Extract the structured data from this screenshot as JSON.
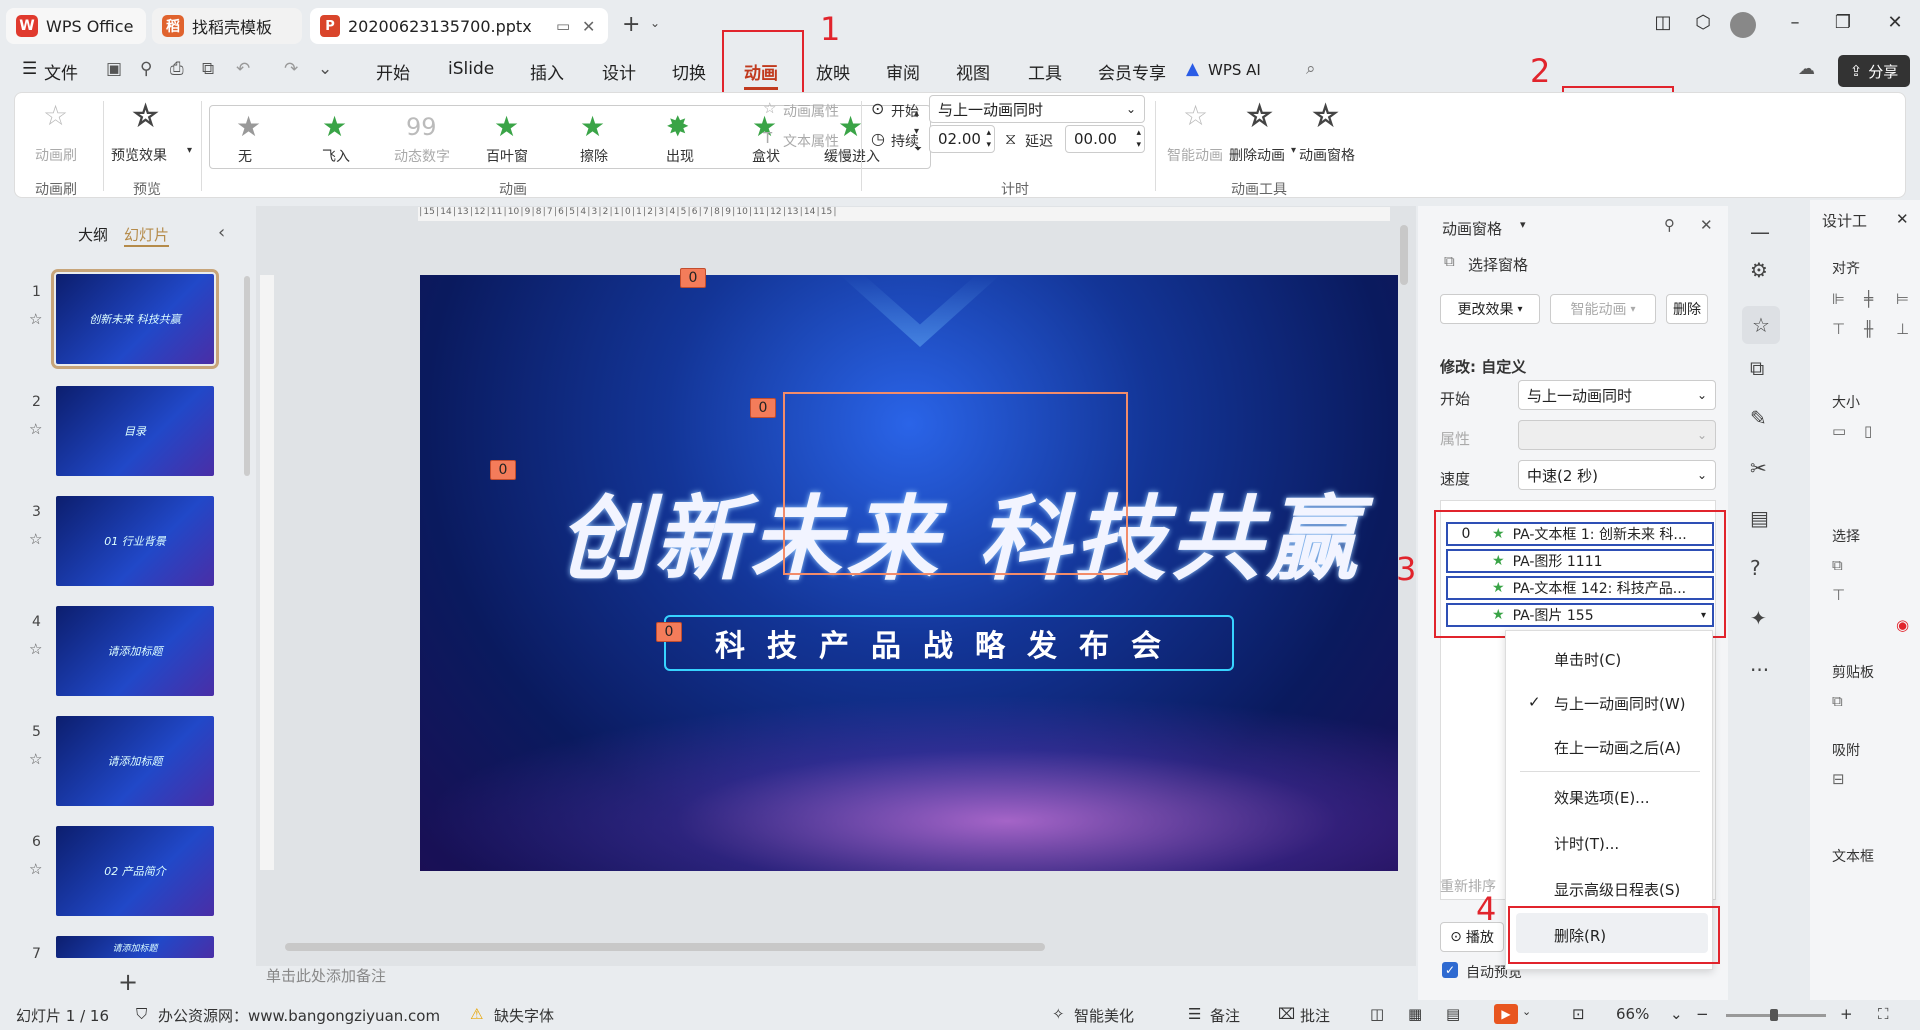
{
  "tabs": {
    "wps": "WPS Office",
    "template": "找稻壳模板",
    "file": "20200623135700.pptx"
  },
  "menu": {
    "file": "文件",
    "items": [
      "开始",
      "iSlide",
      "插入",
      "设计",
      "切换",
      "动画",
      "放映",
      "审阅",
      "视图",
      "工具",
      "会员专享"
    ],
    "ai": "WPS AI",
    "share": "分享"
  },
  "ribbon": {
    "anim_brush": "动画刷",
    "preview": "预览效果",
    "group_brush": "动画刷",
    "group_preview": "预览",
    "effects": [
      "无",
      "飞入",
      "动态数字",
      "百叶窗",
      "擦除",
      "出现",
      "盒状",
      "缓慢进入"
    ],
    "group_anim": "动画",
    "anim_props": "动画属性",
    "text_props": "文本属性",
    "start_label": "开始",
    "start_value": "与上一动画同时",
    "duration_label": "持续",
    "duration_value": "02.00",
    "delay_label": "延迟",
    "delay_value": "00.00",
    "group_timing": "计时",
    "smart_anim": "智能动画",
    "delete_anim": "删除动画",
    "anim_pane": "动画窗格",
    "group_tools": "动画工具"
  },
  "annotations": [
    "1",
    "2",
    "3",
    "4"
  ],
  "outline": {
    "tab_outline": "大纲",
    "tab_slides": "幻灯片"
  },
  "slides": [
    {
      "num": "1",
      "text": "创新未来 科技共赢"
    },
    {
      "num": "2",
      "text": "目录"
    },
    {
      "num": "3",
      "text": "01 行业背景"
    },
    {
      "num": "4",
      "text": "请添加标题"
    },
    {
      "num": "5",
      "text": "请添加标题"
    },
    {
      "num": "6",
      "text": "02 产品简介"
    },
    {
      "num": "7",
      "text": "请添加标题"
    }
  ],
  "slide": {
    "title": "创新未来 科技共赢",
    "subtitle": "科技产品战略发布会",
    "tag": "0"
  },
  "notes_placeholder": "单击此处添加备注",
  "pane": {
    "title": "动画窗格",
    "select_pane": "选择窗格",
    "change_effect": "更改效果",
    "smart_anim": "智能动画",
    "delete": "删除",
    "modify": "修改: 自定义",
    "start_label": "开始",
    "start_value": "与上一动画同时",
    "prop_label": "属性",
    "speed_label": "速度",
    "speed_value": "中速(2 秒)",
    "items": [
      "PA-文本框 1: 创新未来 科...",
      "PA-图形 1111",
      "PA-文本框 142: 科技产品...",
      "PA-图片 155"
    ],
    "item0_num": "0",
    "reorder": "重新排序",
    "play": "播放",
    "auto_preview": "自动预览"
  },
  "context_menu": [
    "单击时(C)",
    "与上一动画同时(W)",
    "在上一动画之后(A)",
    "效果选项(E)...",
    "计时(T)...",
    "显示高级日程表(S)",
    "删除(R)"
  ],
  "design_pane": {
    "title": "设计工",
    "align": "对齐",
    "size": "大小",
    "select": "选择",
    "clipboard": "剪贴板",
    "snap": "吸附",
    "textbox": "文本框"
  },
  "status": {
    "slide_count": "幻灯片 1 / 16",
    "resource": "办公资源网：www.bangongziyuan.com",
    "missing_font": "缺失字体",
    "beautify": "智能美化",
    "notes": "备注",
    "comments": "批注",
    "zoom": "66%"
  },
  "colors": {
    "accent": "#c13a1e",
    "annotation": "#e1242c",
    "anim_tag": "#f47c5a",
    "selection": "#2e4fb5"
  }
}
